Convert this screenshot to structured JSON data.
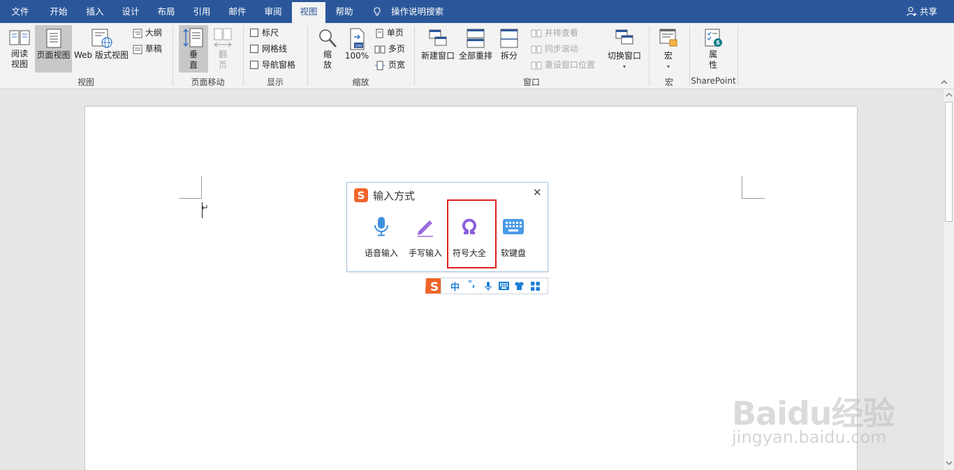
{
  "tabs": [
    {
      "label": "文件"
    },
    {
      "label": "开始"
    },
    {
      "label": "插入"
    },
    {
      "label": "设计"
    },
    {
      "label": "布局"
    },
    {
      "label": "引用"
    },
    {
      "label": "邮件"
    },
    {
      "label": "审阅"
    },
    {
      "label": "视图"
    },
    {
      "label": "帮助"
    }
  ],
  "active_tab": "视图",
  "search": {
    "text": "操作说明搜索",
    "icon": "lightbulb-icon"
  },
  "share": {
    "label": "共享",
    "icon": "person-add-icon"
  },
  "ribbon": {
    "views": {
      "group": "视图",
      "read_mode": "阅读\n视图",
      "read_mode_l1": "阅读",
      "read_mode_l2": "视图",
      "print_layout": "页面视图",
      "web_layout": "Web 版式视图",
      "outline": "大纲",
      "draft": "草稿"
    },
    "page_movement": {
      "group": "页面移动",
      "vertical_l1": "垂",
      "vertical_l2": "直",
      "side_l1": "翻",
      "side_l2": "页"
    },
    "show": {
      "group": "显示",
      "ruler": "标尺",
      "gridlines": "网格线",
      "nav_pane": "导航窗格"
    },
    "zoom": {
      "group": "缩放",
      "zoom_l1": "缩",
      "zoom_l2": "放",
      "hundred": "100%",
      "one_page": "单页",
      "multi_page": "多页",
      "page_width": "页宽"
    },
    "window": {
      "group": "窗口",
      "new_window": "新建窗口",
      "arrange_all": "全部重排",
      "split": "拆分",
      "side_by_side": "并排查看",
      "sync_scroll": "同步滚动",
      "reset_position": "重设窗口位置",
      "switch_windows": "切换窗口"
    },
    "macros": {
      "group": "宏",
      "macros": "宏"
    },
    "sharepoint": {
      "group": "SharePoint",
      "props_l1": "属",
      "props_l2": "性"
    }
  },
  "ime_popup": {
    "title": "输入方式",
    "items": [
      {
        "label": "语音输入",
        "icon": "microphone-icon"
      },
      {
        "label": "手写输入",
        "icon": "pencil-icon"
      },
      {
        "label": "符号大全",
        "icon": "omega-icon"
      },
      {
        "label": "软键盘",
        "icon": "keyboard-icon"
      }
    ],
    "highlighted": "符号大全",
    "close": "✕"
  },
  "ime_bar": {
    "mode": "中",
    "punct": "°,"
  },
  "watermark": {
    "brand": "Baidu经验",
    "sub": "jingyan.baidu.com"
  },
  "colors": {
    "titlebar": "#2b579a",
    "ribbon": "#f3f3f3",
    "highlight": "#e02020",
    "ime_accent": "#1e7fd6"
  }
}
